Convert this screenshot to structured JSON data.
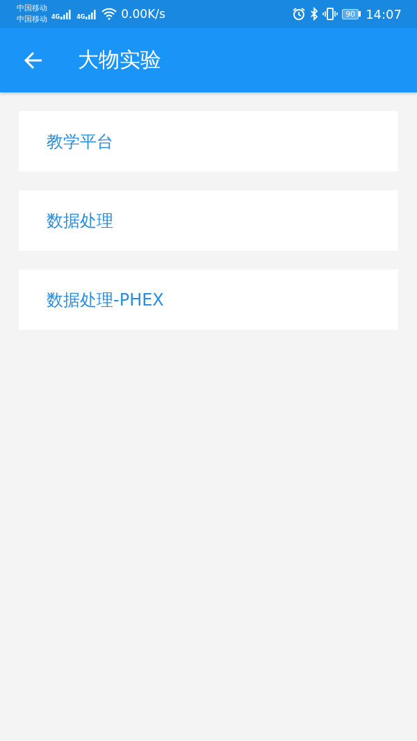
{
  "status_bar": {
    "carriers": [
      "中国移动",
      "中国移动"
    ],
    "networks": [
      "4G",
      "4G"
    ],
    "speed": "0.00K/s",
    "battery": "90",
    "time": "14:07"
  },
  "app_bar": {
    "title": "大物实验"
  },
  "menu_items": [
    {
      "label": "教学平台"
    },
    {
      "label": "数据处理"
    },
    {
      "label": "数据处理-PHEX"
    }
  ]
}
